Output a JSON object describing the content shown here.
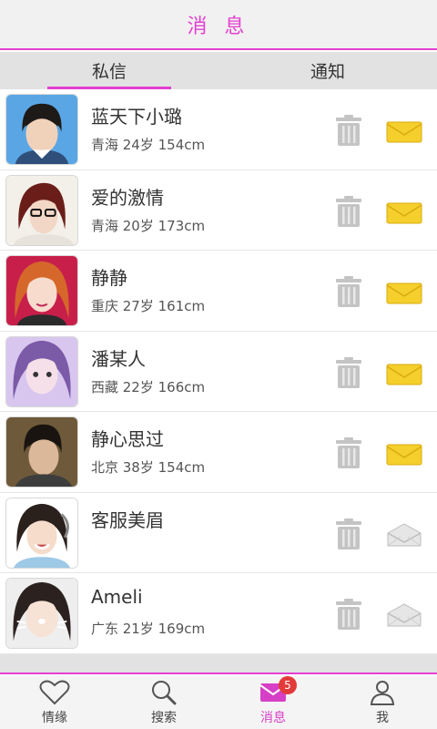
{
  "header": {
    "title": "消 息"
  },
  "tabs": [
    {
      "label": "私信",
      "active": true
    },
    {
      "label": "通知",
      "active": false
    }
  ],
  "messages": [
    {
      "name": "蓝天下小璐",
      "meta": "青海 24岁 154cm",
      "read": false
    },
    {
      "name": "爱的激情",
      "meta": "青海 20岁 173cm",
      "read": false
    },
    {
      "name": "静静",
      "meta": "重庆 27岁 161cm",
      "read": false
    },
    {
      "name": "潘某人",
      "meta": "西藏 22岁 166cm",
      "read": false
    },
    {
      "name": "静心思过",
      "meta": "北京 38岁 154cm",
      "read": false
    },
    {
      "name": "客服美眉",
      "meta": "",
      "read": true
    },
    {
      "name": "Ameli",
      "meta": "广东 21岁 169cm",
      "read": true
    }
  ],
  "icons": {
    "delete": "trash-icon",
    "unread": "envelope-closed-icon",
    "read": "envelope-open-icon"
  },
  "colors": {
    "accent": "#e33fd0",
    "unread_mail": "#f5cf2b",
    "badge": "#e23a3a"
  },
  "bottom_nav": [
    {
      "label": "情缘",
      "icon": "heart-icon"
    },
    {
      "label": "搜索",
      "icon": "search-icon"
    },
    {
      "label": "消息",
      "icon": "mail-icon",
      "active": true,
      "badge": "5"
    },
    {
      "label": "我",
      "icon": "person-icon"
    }
  ]
}
